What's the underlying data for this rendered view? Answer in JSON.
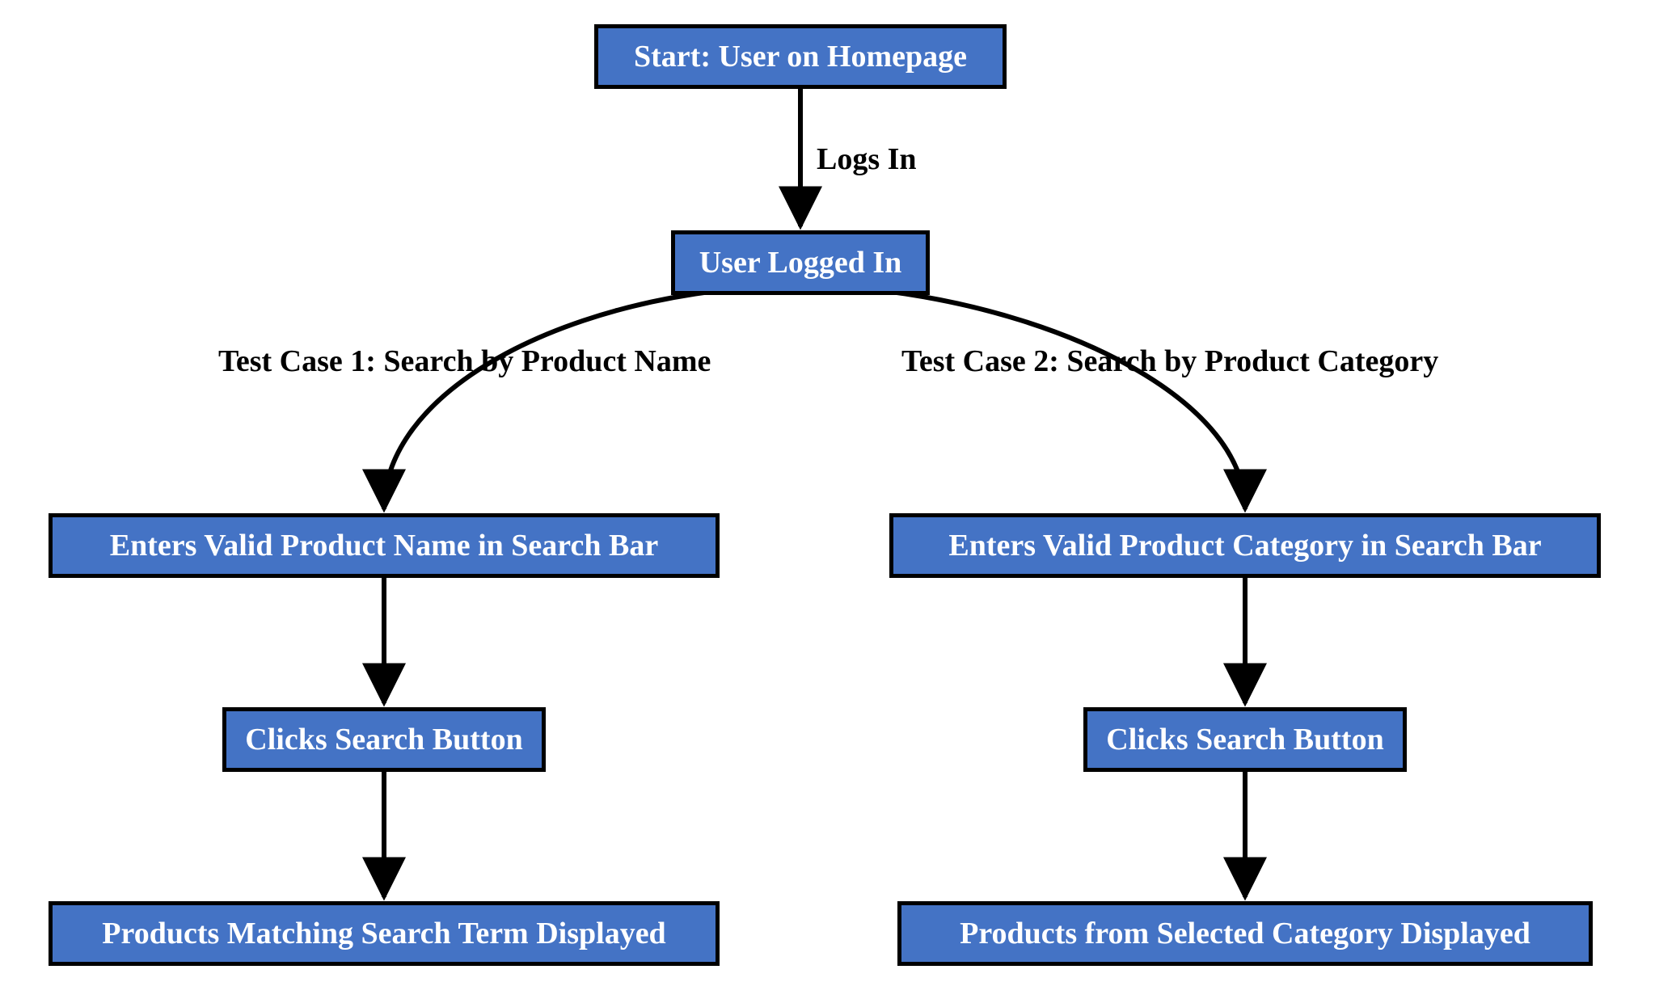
{
  "nodes": {
    "start": "Start: User on Homepage",
    "logged_in": "User Logged In",
    "left_enter": "Enters Valid Product Name in Search Bar",
    "left_click": "Clicks Search Button",
    "left_result": "Products Matching Search Term Displayed",
    "right_enter": "Enters Valid Product Category in Search Bar",
    "right_click": "Clicks Search Button",
    "right_result": "Products from Selected Category Displayed"
  },
  "edges": {
    "logs_in": "Logs In",
    "tc1": "Test Case 1: Search by Product Name",
    "tc2": "Test Case 2: Search by Product Category"
  },
  "colors": {
    "box_fill": "#4473c5",
    "border": "#000000",
    "text_on_box": "#ffffff",
    "edge": "#000000",
    "bg": "#ffffff"
  }
}
